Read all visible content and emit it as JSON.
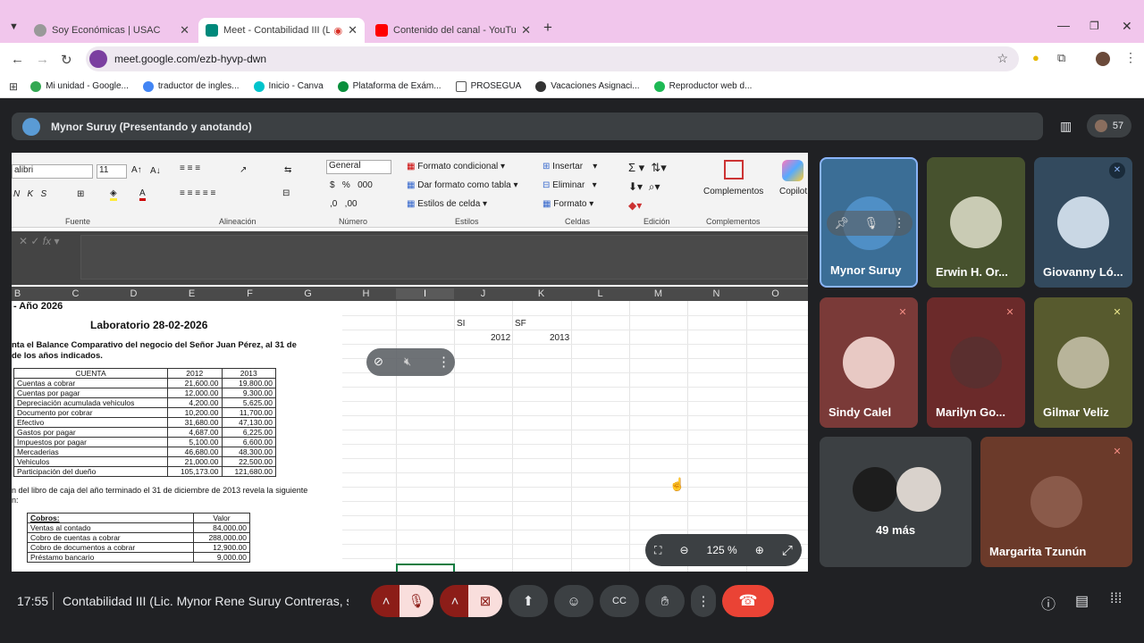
{
  "browser": {
    "tabs": [
      {
        "title": "Soy Económicas | USAC",
        "icon": "globe-icon"
      },
      {
        "title": "Meet - Contabilidad III (Lic.",
        "icon": "meet-icon",
        "active": true
      },
      {
        "title": "Contenido del canal - YouTube",
        "icon": "youtube-icon"
      }
    ],
    "url": "meet.google.com/ezb-hyvp-dwn",
    "bookmarks": [
      "Mi unidad - Google...",
      "traductor de ingles...",
      "Inicio - Canva",
      "Plataforma de Exám...",
      "PROSEGUA",
      "Vacaciones Asignaci...",
      "Reproductor web d..."
    ]
  },
  "presentation": {
    "title": "Mynor Suruy (Presentando y anotando)",
    "participant_count": "57"
  },
  "excel": {
    "font_name": "alibri",
    "font_size": "11",
    "number_format": "General",
    "ribbon": {
      "cond_format": "Formato condicional",
      "table_format": "Dar formato como tabla",
      "cell_styles": "Estilos de celda",
      "insert": "Insertar",
      "delete": "Eliminar",
      "format": "Formato",
      "addins": "Complementos",
      "copilot": "Copilot"
    },
    "groups": [
      "Fuente",
      "Alineación",
      "Número",
      "Estilos",
      "Celdas",
      "Edición",
      "Complementos"
    ],
    "columns": [
      "B",
      "C",
      "D",
      "E",
      "F",
      "G",
      "H",
      "I",
      "J",
      "K",
      "L",
      "M",
      "N",
      "O"
    ],
    "cells": {
      "si": "SI",
      "sf": "SF",
      "y2012": "2012",
      "y2013": "2013"
    }
  },
  "document": {
    "year_header": "- Año 2026",
    "lab_title": "Laboratorio 28-02-2026",
    "intro": "nta el Balance Comparativo del negocio del Señor Juan Pérez, al 31 de",
    "intro2": "de los años indicados.",
    "table_headers": [
      "CUENTA",
      "2012",
      "2013"
    ],
    "rows": [
      [
        "Cuentas a cobrar",
        "21,600.00",
        "19,800.00"
      ],
      [
        "Cuentas por pagar",
        "12,000.00",
        "9,300.00"
      ],
      [
        "Depreciación acumulada vehiculos",
        "4,200.00",
        "5,625.00"
      ],
      [
        "Documento por cobrar",
        "10,200.00",
        "11,700.00"
      ],
      [
        "Efectivo",
        "31,680.00",
        "47,130.00"
      ],
      [
        "Gastos por pagar",
        "4,687.00",
        "6,225.00"
      ],
      [
        "Impuestos por pagar",
        "5,100.00",
        "6,600.00"
      ],
      [
        "Mercaderias",
        "46,680.00",
        "48,300.00"
      ],
      [
        "Vehiculos",
        "21,000.00",
        "22,500.00"
      ],
      [
        "Participación del dueño",
        "105,173.00",
        "121,680.00"
      ]
    ],
    "note": "n del libro de caja del año terminado el 31 de diciembre de 2013 revela la siguiente",
    "note2": "n:",
    "cobros_headers": [
      "Cobros:",
      "Valor"
    ],
    "cobros": [
      [
        "Ventas al contado",
        "84,000.00"
      ],
      [
        "Cobro de cuentas a cobrar",
        "288,000.00"
      ],
      [
        "Cobro de documentos a cobrar",
        "12,900.00"
      ],
      [
        "Préstamo bancario",
        "9,000.00"
      ]
    ]
  },
  "zoom": {
    "level": "125 %"
  },
  "participants": [
    {
      "name": "Mynor Suruy",
      "muted": true
    },
    {
      "name": "Erwin H. Or...",
      "muted": false
    },
    {
      "name": "Giovanny Ló...",
      "muted": true
    },
    {
      "name": "Sindy Calel",
      "muted": true
    },
    {
      "name": "Marilyn Go...",
      "muted": true
    },
    {
      "name": "Gilmar Veliz",
      "muted": true
    },
    {
      "name": "49 más",
      "muted": false
    },
    {
      "name": "Margarita Tzunún",
      "muted": true
    }
  ],
  "meeting": {
    "time": "17:55",
    "title": "Contabilidad III (Lic. Mynor Rene Suruy Contreras, s..."
  }
}
